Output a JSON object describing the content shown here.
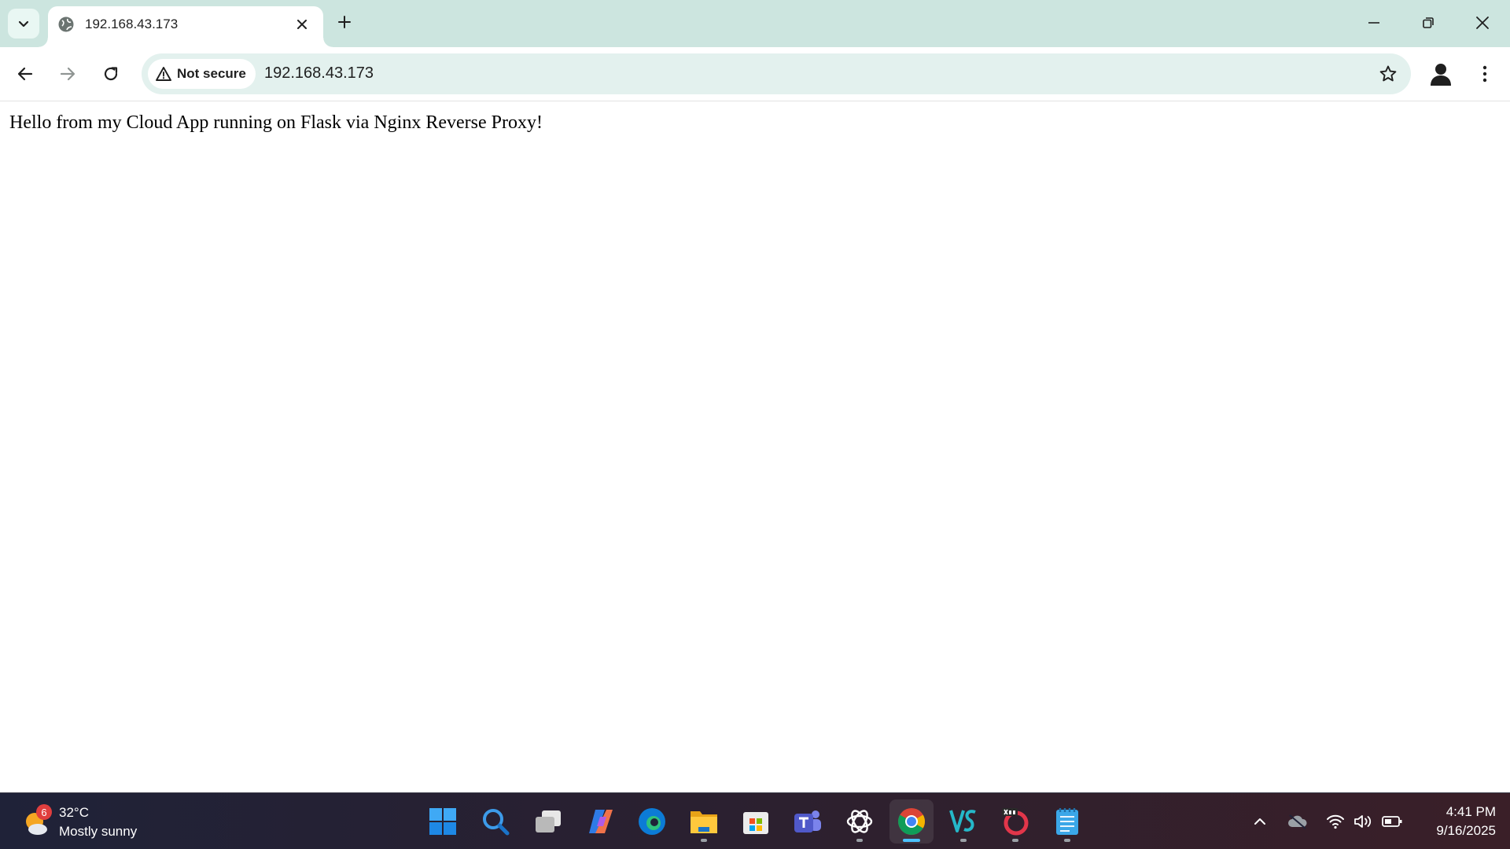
{
  "browser": {
    "tab": {
      "title": "192.168.43.173"
    },
    "omnibox": {
      "security_label": "Not secure",
      "url": "192.168.43.173"
    }
  },
  "page": {
    "body_text": "Hello from my Cloud App running on Flask via Nginx Reverse Proxy!"
  },
  "taskbar": {
    "weather": {
      "badge_count": "6",
      "temperature": "32°C",
      "condition": "Mostly sunny"
    },
    "apps": [
      {
        "name": "start-icon"
      },
      {
        "name": "search-icon"
      },
      {
        "name": "task-view-icon"
      },
      {
        "name": "copilot-icon"
      },
      {
        "name": "edge-icon"
      },
      {
        "name": "file-explorer-icon"
      },
      {
        "name": "microsoft-store-icon"
      },
      {
        "name": "teams-icon"
      },
      {
        "name": "chatgpt-icon"
      },
      {
        "name": "chrome-icon",
        "active": true
      },
      {
        "name": "vs-icon"
      },
      {
        "name": "x64-app-icon"
      },
      {
        "name": "notepad-icon"
      }
    ],
    "clock": {
      "time": "4:41 PM",
      "date": "9/16/2025"
    }
  },
  "colors": {
    "titlebar": "#cce5df",
    "omnibox": "#e3f1ee",
    "active_indicator": "#4cc2ff"
  }
}
